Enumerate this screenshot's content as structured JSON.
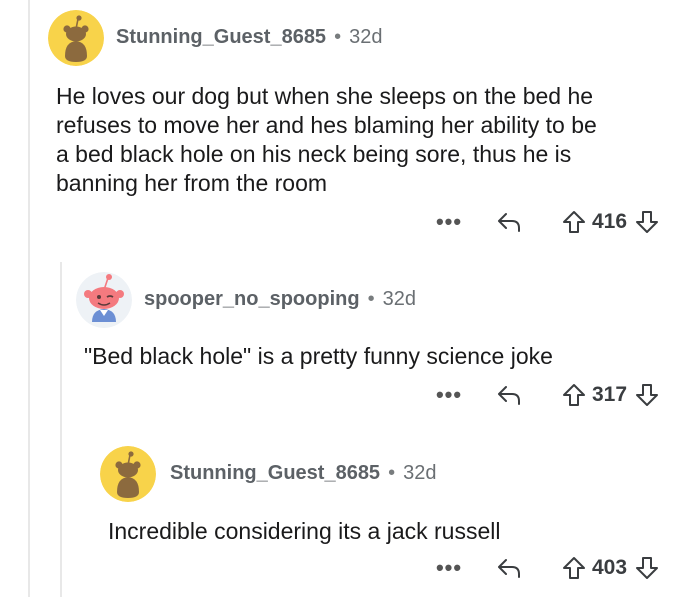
{
  "comments": [
    {
      "username": "Stunning_Guest_8685",
      "separator": "•",
      "age": "32d",
      "body_lines": [
        "He loves our dog but when she sleeps on the bed he",
        "refuses to move her and hes blaming her ability to be",
        "a bed black hole on his neck being sore, thus he is",
        "banning her from the room"
      ],
      "score": "416",
      "avatar": "yellow-default-snoo"
    },
    {
      "username": "spooper_no_spooping",
      "separator": "•",
      "age": "32d",
      "body_lines": [
        "\"Bed black hole\" is a pretty funny science joke"
      ],
      "score": "317",
      "avatar": "pink-winking-snoo"
    },
    {
      "username": "Stunning_Guest_8685",
      "separator": "•",
      "age": "32d",
      "body_lines": [
        "Incredible considering its a jack russell"
      ],
      "score": "403",
      "avatar": "yellow-default-snoo"
    }
  ],
  "icons": {
    "more": "more-options-icon",
    "reply": "reply-arrow-icon",
    "upvote": "upvote-arrow-icon",
    "downvote": "downvote-arrow-icon"
  },
  "more_label": "•••",
  "colors": {
    "yellow_avatar": "#f8d34a",
    "snoo_body": "#8c6a3e",
    "pink_snoo": "#f47a7f",
    "thread_line": "#e8e8e8"
  }
}
